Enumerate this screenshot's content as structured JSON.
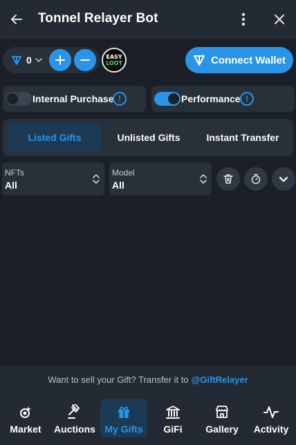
{
  "header": {
    "title": "Tonnel Relayer Bot",
    "back_icon": "arrow-left-icon",
    "more_icon": "vertical-dots-icon",
    "close_icon": "close-icon"
  },
  "toolbar": {
    "ton_balance": "0",
    "easy_loot": {
      "line1": "EASY",
      "line2": "LOOT"
    },
    "connect_wallet_label": "Connect Wallet"
  },
  "toggles": [
    {
      "label": "Internal Purchase",
      "enabled": false
    },
    {
      "label": "Performance",
      "enabled": true
    }
  ],
  "tabs": [
    {
      "label": "Listed Gifts",
      "active": true
    },
    {
      "label": "Unlisted Gifts",
      "active": false
    },
    {
      "label": "Instant Transfer",
      "active": false
    }
  ],
  "filters": {
    "nfts": {
      "label": "NFTs",
      "value": "All"
    },
    "model": {
      "label": "Model",
      "value": "All"
    }
  },
  "promo": {
    "text": "Want to sell your Gift? Transfer it to",
    "handle": "@GiftRelayer"
  },
  "bottom_nav": [
    {
      "label": "Market",
      "icon": "market-icon",
      "active": false
    },
    {
      "label": "Auctions",
      "icon": "gavel-icon",
      "active": false
    },
    {
      "label": "My Gifts",
      "icon": "gift-icon",
      "active": true
    },
    {
      "label": "GiFi",
      "icon": "bank-icon",
      "active": false
    },
    {
      "label": "Gallery",
      "icon": "storefront-icon",
      "active": false
    },
    {
      "label": "Activity",
      "icon": "activity-icon",
      "active": false
    }
  ],
  "colors": {
    "accent": "#2a95e6",
    "background": "#1b2028",
    "panel": "#283039",
    "header": "#232a33",
    "active_tab_bg": "#1d3a55"
  }
}
